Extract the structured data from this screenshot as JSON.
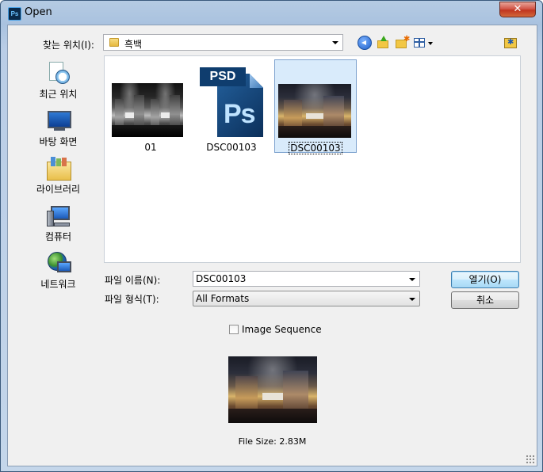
{
  "window": {
    "title": "Open",
    "app_icon": "Ps"
  },
  "toolbar": {
    "look_in_label": "찾는 위치(I):",
    "look_in_value": "흑백",
    "icons": [
      "back-icon",
      "up-folder-icon",
      "new-folder-icon",
      "views-menu-icon",
      "bookmark-folder-icon"
    ]
  },
  "places": [
    {
      "label": "최근 위치",
      "icon": "recent-places-icon"
    },
    {
      "label": "바탕 화면",
      "icon": "desktop-icon"
    },
    {
      "label": "라이브러리",
      "icon": "library-icon"
    },
    {
      "label": "컴퓨터",
      "icon": "computer-icon"
    },
    {
      "label": "네트워크",
      "icon": "network-icon"
    }
  ],
  "files": [
    {
      "name": "01",
      "type": "image-thumbnail-grayscale",
      "selected": false
    },
    {
      "name": "DSC00103",
      "type": "psd-file-icon",
      "icon_text_banner": "PSD",
      "icon_text_logo": "Ps",
      "selected": false
    },
    {
      "name": "DSC00103",
      "type": "image-thumbnail",
      "selected": true
    }
  ],
  "form": {
    "filename_label": "파일 이름(N):",
    "filename_value": "DSC00103",
    "filetype_label": "파일 형식(T):",
    "filetype_value": "All Formats"
  },
  "buttons": {
    "open": "열기(O)",
    "cancel": "취소"
  },
  "image_sequence_label": "Image Sequence",
  "file_size": "File Size: 2.83M"
}
